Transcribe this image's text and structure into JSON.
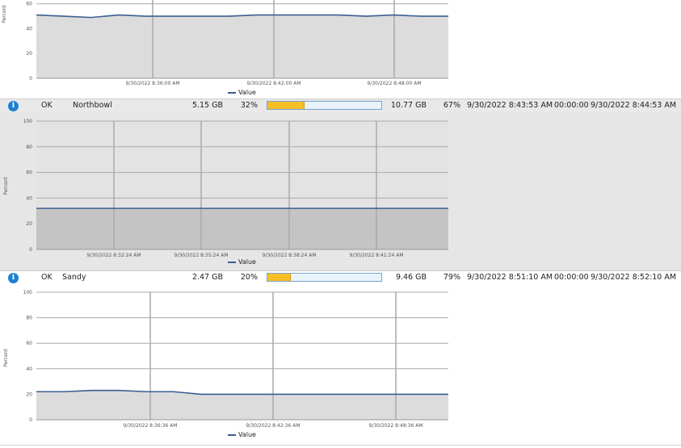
{
  "colors": {
    "series_line": "#3a5f8f",
    "plot_area": "#dcdcdc",
    "plot_area_shaded": "#c4c4c4",
    "capacity_fill": "#f6bf26",
    "capacity_track": "#e8f3fc",
    "info_icon": "#1e7fd6"
  },
  "rows": [
    {
      "status_icon": "info-icon",
      "icon_glyph": "i",
      "status": "OK",
      "name": "Northbowl",
      "used": "5.15 GB",
      "used_pct": "32%",
      "used_fraction": 0.32,
      "free": "10.77 GB",
      "free_pct": "67%",
      "last_check": "9/30/2022 8:43:53 AM",
      "duration": "00:00:00",
      "next_check": "9/30/2022 8:44:53 AM"
    },
    {
      "status_icon": "info-icon",
      "icon_glyph": "i",
      "status": "OK",
      "name": "Sandy",
      "used": "2.47 GB",
      "used_pct": "20%",
      "used_fraction": 0.2,
      "free": "9.46 GB",
      "free_pct": "79%",
      "last_check": "9/30/2022 8:51:10 AM",
      "duration": "00:00:00",
      "next_check": "9/30/2022 8:52:10 AM"
    }
  ],
  "chart_data": [
    {
      "type": "area",
      "ylabel": "Percent",
      "xlabel": "",
      "ylim": [
        0,
        65
      ],
      "yticks": [
        "0",
        "20",
        "40",
        "60"
      ],
      "xtick_labels": [
        "9/30/2022 8:36:00 AM",
        "9/30/2022 8:42:00 AM",
        "9/30/2022 8:48:00 AM"
      ],
      "legend": [
        "Value"
      ],
      "legend_position": "bottom",
      "grid": true,
      "series": [
        {
          "name": "Value",
          "values": [
            51,
            50,
            49,
            51,
            50,
            50,
            50,
            50,
            51,
            51,
            51,
            51,
            50,
            51,
            50,
            50
          ]
        }
      ]
    },
    {
      "type": "area",
      "ylabel": "Percent",
      "xlabel": "",
      "ylim": [
        0,
        100
      ],
      "yticks": [
        "0",
        "20",
        "40",
        "60",
        "80",
        "100"
      ],
      "xtick_labels": [
        "9/30/2022 8:32:24 AM",
        "9/30/2022 8:35:24 AM",
        "9/30/2022 8:38:24 AM",
        "9/30/2022 8:41:24 AM"
      ],
      "legend": [
        "Value"
      ],
      "legend_position": "bottom",
      "grid": true,
      "series": [
        {
          "name": "Value",
          "values": [
            32,
            32,
            32,
            32,
            32,
            32,
            32,
            32,
            32,
            32
          ]
        }
      ]
    },
    {
      "type": "area",
      "ylabel": "Percent",
      "xlabel": "",
      "ylim": [
        0,
        100
      ],
      "yticks": [
        "0",
        "20",
        "40",
        "60",
        "80",
        "100"
      ],
      "xtick_labels": [
        "9/30/2022 8:36:36 AM",
        "9/30/2022 8:42:36 AM",
        "9/30/2022 8:48:36 AM"
      ],
      "legend": [
        "Value"
      ],
      "legend_position": "bottom",
      "grid": true,
      "series": [
        {
          "name": "Value",
          "values": [
            22,
            22,
            23,
            23,
            22,
            22,
            20,
            20,
            20,
            20,
            20,
            20,
            20,
            20,
            20,
            20
          ]
        }
      ]
    }
  ]
}
